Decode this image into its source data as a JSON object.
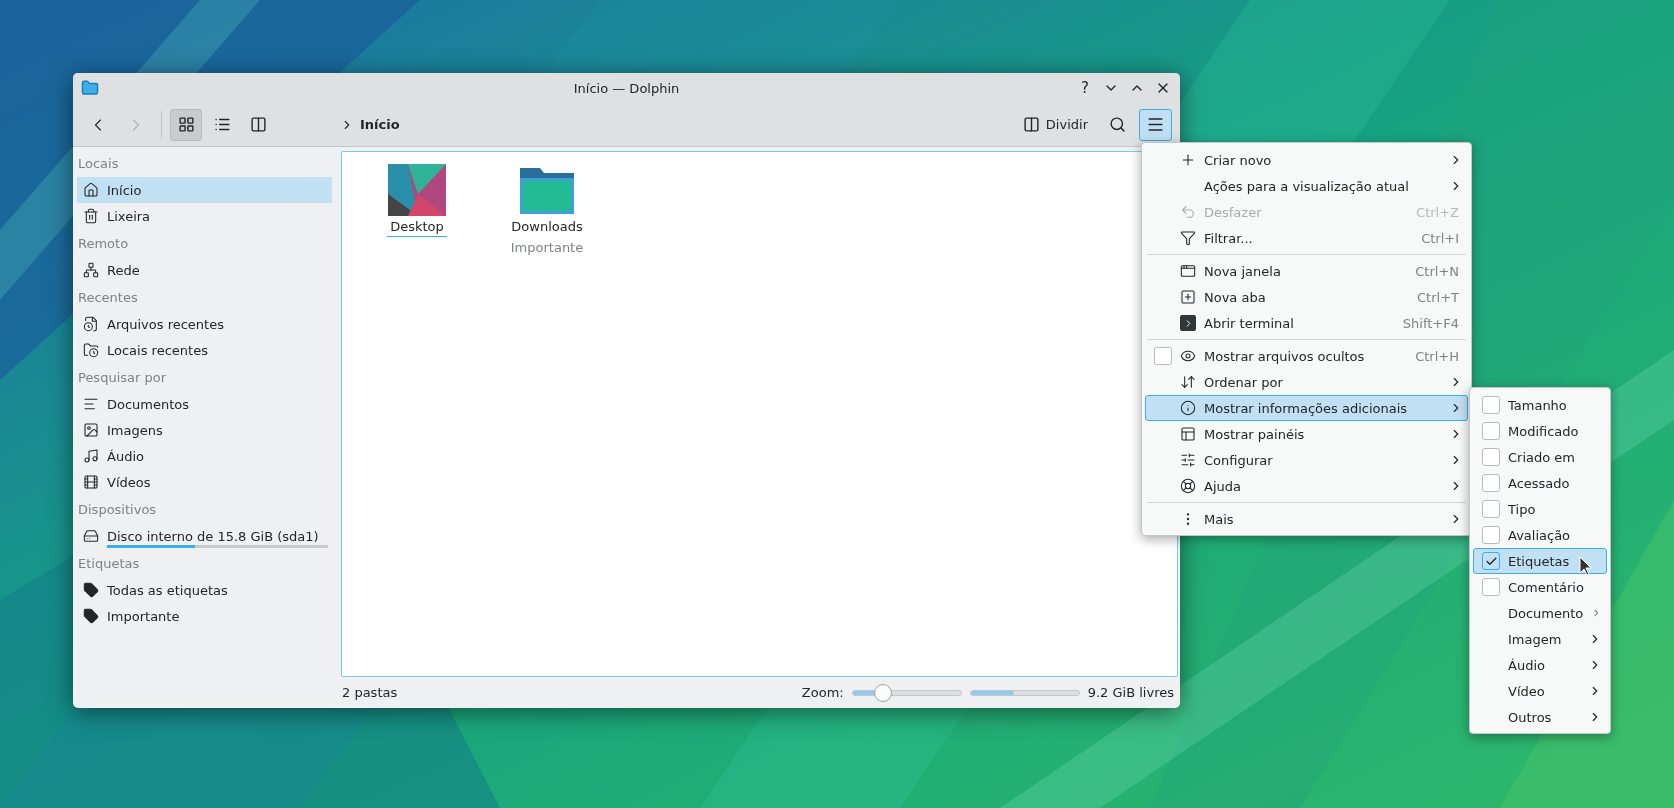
{
  "window": {
    "title": "Início — Dolphin",
    "help_button": "?"
  },
  "toolbar": {
    "view_modes": [
      {
        "selected": true
      },
      {
        "selected": false
      },
      {
        "selected": false
      }
    ],
    "breadcrumb": "Início",
    "split_button": "Dividir",
    "menu_open": true
  },
  "sidebar": {
    "sections": [
      {
        "title": "Locais",
        "items": [
          {
            "label": "Início",
            "selected": true
          },
          {
            "label": "Lixeira",
            "selected": false
          }
        ]
      },
      {
        "title": "Remoto",
        "items": [
          {
            "label": "Rede",
            "selected": false
          }
        ]
      },
      {
        "title": "Recentes",
        "items": [
          {
            "label": "Arquivos recentes",
            "selected": false
          },
          {
            "label": "Locais recentes",
            "selected": false
          }
        ]
      },
      {
        "title": "Pesquisar por",
        "items": [
          {
            "label": "Documentos",
            "selected": false
          },
          {
            "label": "Imagens",
            "selected": false
          },
          {
            "label": "Áudio",
            "selected": false
          },
          {
            "label": "Vídeos",
            "selected": false
          }
        ]
      },
      {
        "title": "Dispositivos",
        "items": [
          {
            "label": "Disco interno de 15.8 GiB (sda1)",
            "selected": false,
            "level": 0.4
          }
        ]
      },
      {
        "title": "Etiquetas",
        "items": [
          {
            "label": "Todas as etiquetas",
            "selected": false
          },
          {
            "label": "Importante",
            "selected": false
          }
        ]
      }
    ]
  },
  "files": [
    {
      "kind": "picture",
      "name": "Desktop",
      "selected": true
    },
    {
      "kind": "folder",
      "name": "Downloads",
      "tag": "Importante",
      "selected": false
    }
  ],
  "status_bar": {
    "text": "2 pastas",
    "zoom_label": "Zoom:",
    "zoom": {
      "level": 0.28
    },
    "space": {
      "level": 0.4
    },
    "free_space": "9.2 GiB livres"
  },
  "menu": {
    "items": [
      {
        "kind": "submenu",
        "label": "Criar novo",
        "selected": false
      },
      {
        "kind": "submenu",
        "label": "Ações para a visualização atual",
        "selected": false
      },
      {
        "kind": "action",
        "label": "Desfazer",
        "shortcut": "Ctrl+Z",
        "disabled": true,
        "selected": false
      },
      {
        "kind": "action",
        "label": "Filtrar...",
        "shortcut": "Ctrl+I",
        "disabled": false,
        "selected": false
      },
      {
        "kind": "separator"
      },
      {
        "kind": "action",
        "label": "Nova janela",
        "shortcut": "Ctrl+N",
        "disabled": false,
        "selected": false
      },
      {
        "kind": "action",
        "label": "Nova aba",
        "shortcut": "Ctrl+T",
        "disabled": false,
        "selected": false
      },
      {
        "kind": "action",
        "label": "Abrir terminal",
        "shortcut": "Shift+F4",
        "disabled": false,
        "selected": false
      },
      {
        "kind": "separator"
      },
      {
        "kind": "check",
        "label": "Mostrar arquivos ocultos",
        "shortcut": "Ctrl+H",
        "checked": false,
        "selected": false
      },
      {
        "kind": "submenu",
        "label": "Ordenar por",
        "selected": false
      },
      {
        "kind": "submenu",
        "label": "Mostrar informações adicionais",
        "selected": true
      },
      {
        "kind": "submenu",
        "label": "Mostrar painéis",
        "selected": false
      },
      {
        "kind": "submenu",
        "label": "Configurar",
        "selected": false
      },
      {
        "kind": "submenu",
        "label": "Ajuda",
        "selected": false
      },
      {
        "kind": "separator"
      },
      {
        "kind": "submenu",
        "label": "Mais",
        "selected": false
      }
    ]
  },
  "submenu": {
    "items": [
      {
        "kind": "check",
        "label": "Tamanho",
        "checked": false,
        "selected": false
      },
      {
        "kind": "check",
        "label": "Modificado",
        "checked": false,
        "selected": false
      },
      {
        "kind": "check",
        "label": "Criado em",
        "checked": false,
        "selected": false
      },
      {
        "kind": "check",
        "label": "Acessado",
        "checked": false,
        "selected": false
      },
      {
        "kind": "check",
        "label": "Tipo",
        "checked": false,
        "selected": false
      },
      {
        "kind": "check",
        "label": "Avaliação",
        "checked": false,
        "selected": false
      },
      {
        "kind": "check",
        "label": "Etiquetas",
        "checked": true,
        "selected": true
      },
      {
        "kind": "check",
        "label": "Comentário",
        "checked": false,
        "selected": false
      },
      {
        "kind": "submenu",
        "label": "Documento",
        "selected": false
      },
      {
        "kind": "submenu",
        "label": "Imagem",
        "selected": false
      },
      {
        "kind": "submenu",
        "label": "Áudio",
        "selected": false
      },
      {
        "kind": "submenu",
        "label": "Vídeo",
        "selected": false
      },
      {
        "kind": "submenu",
        "label": "Outros",
        "selected": false
      }
    ]
  }
}
